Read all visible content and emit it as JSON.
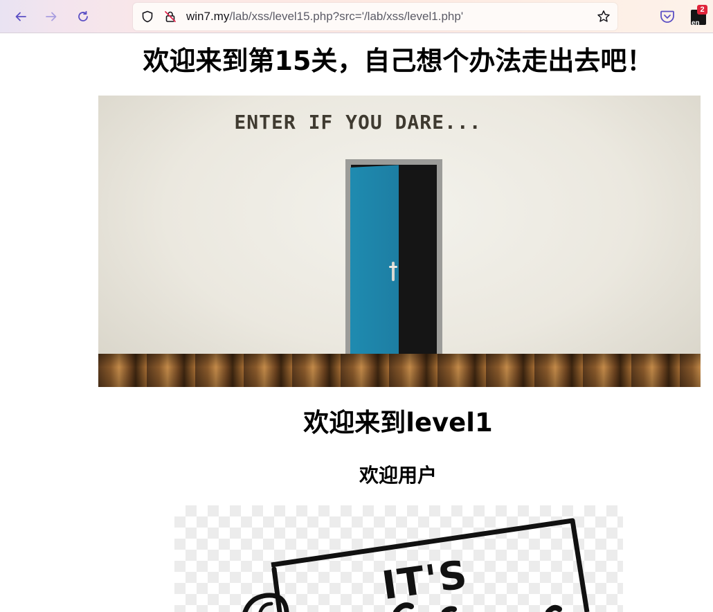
{
  "browser": {
    "url_host": "win7.my",
    "url_path": "/lab/xss/level15.php?src='/lab/xss/level1.php'",
    "extension_badge": "2",
    "extension_label": "en"
  },
  "page": {
    "title": "欢迎来到第15关，自己想个办法走出去吧！",
    "door_caption": "ENTER IF YOU DARE...",
    "subtitle": "欢迎来到level1",
    "greeting": "欢迎用户",
    "sign_caption": "IT'S"
  },
  "colors": {
    "door": "#1f8bb0",
    "heading": "#000000"
  },
  "icons": [
    "back-arrow-icon",
    "forward-arrow-icon",
    "reload-icon",
    "shield-icon",
    "insecure-lock-icon",
    "bookmark-star-icon",
    "pocket-icon",
    "extension-icon"
  ]
}
